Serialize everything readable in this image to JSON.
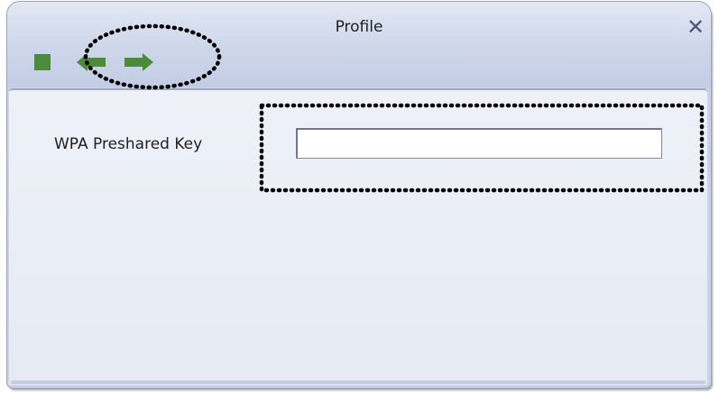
{
  "window": {
    "title": "Profile",
    "close_icon": "close-icon"
  },
  "toolbar": {
    "buttons": [
      {
        "icon": "stop-icon",
        "color": "#4e8a3c"
      },
      {
        "icon": "back-arrow-icon",
        "color": "#4e8a3c"
      },
      {
        "icon": "forward-arrow-icon",
        "color": "#4e8a3c"
      }
    ]
  },
  "form": {
    "wpa_key_label": "WPA Preshared Key",
    "wpa_key_value": ""
  },
  "colors": {
    "titlebar": "#cdd6ea",
    "panel": "#eef1f8",
    "accent_green": "#4e8a3c",
    "close": "#4a5a7a"
  }
}
